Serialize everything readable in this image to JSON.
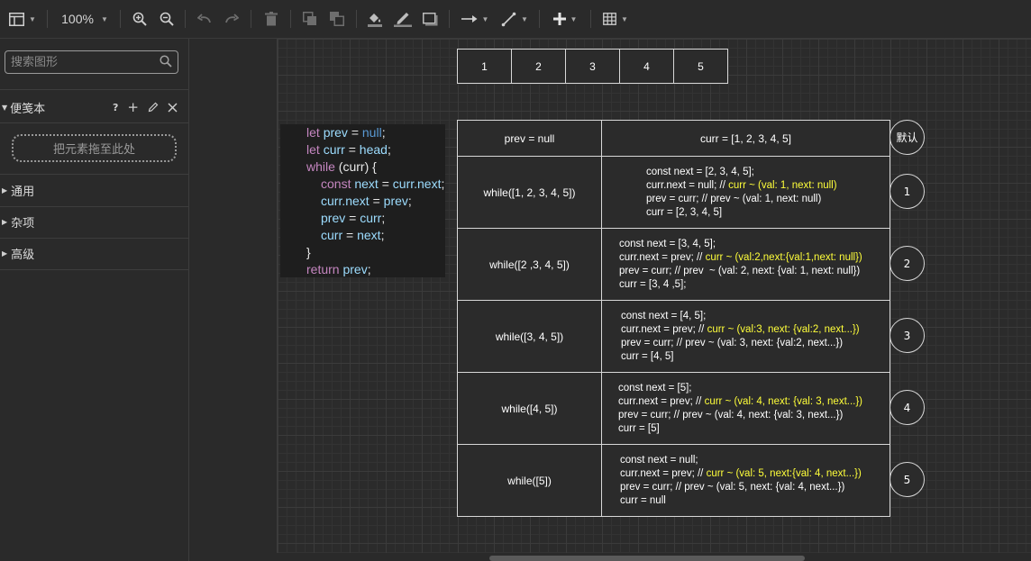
{
  "toolbar": {
    "zoom": "100%",
    "icons": [
      "panel-layout-icon",
      "zoom-in-icon",
      "zoom-out-icon",
      "undo-icon",
      "redo-icon",
      "delete-icon",
      "to-front-icon",
      "to-back-icon",
      "fill-color-icon",
      "line-color-icon",
      "shadow-icon",
      "connection-icon",
      "waypoints-icon",
      "insert-plus-icon",
      "table-icon"
    ]
  },
  "sidebar": {
    "search_placeholder": "搜索图形",
    "scratchpad": {
      "title": "便笺本",
      "help": "?",
      "add": "+"
    },
    "dropzone": "把元素拖至此处",
    "categories": [
      "通用",
      "杂项",
      "高级"
    ]
  },
  "diagram": {
    "array": [
      "1",
      "2",
      "3",
      "4",
      "5"
    ],
    "code": {
      "l1": [
        "let",
        "prev",
        "=",
        "null",
        ";"
      ],
      "l2": [
        "let",
        "curr",
        "=",
        "head",
        ";"
      ],
      "l3": [
        "while",
        "(curr) {"
      ],
      "l4": [
        "const",
        "next",
        "=",
        "curr.next",
        ";"
      ],
      "l5": [
        "curr.next",
        "=",
        "prev",
        ";"
      ],
      "l6": [
        "prev",
        "=",
        "curr",
        ";"
      ],
      "l7": [
        "curr",
        "=",
        "next",
        ";"
      ],
      "l8": "}",
      "l9": [
        "return",
        "prev",
        ";"
      ]
    },
    "header": {
      "left": "prev = null",
      "right": "curr = [1, 2, 3, 4, 5]",
      "badge": "默认"
    },
    "rows": [
      {
        "cond": "while([1, 2, 3, 4, 5])",
        "l1": "const next = [2, 3, 4, 5];",
        "l2a": "curr.next = null; // ",
        "l2b": "curr ~ (val: 1, next: null)",
        "l3": "prev = curr; // prev ~ (val: 1, next: null)",
        "l4": "curr = [2, 3, 4, 5]",
        "badge": "1"
      },
      {
        "cond": "while([2 ,3, 4, 5])",
        "l1": "const next = [3, 4, 5];",
        "l2a": "curr.next = prev; // ",
        "l2b": "curr ~ (val:2,next:{val:1,next: null})",
        "l3": "prev = curr; // prev  ~ (val: 2, next: {val: 1, next: null})",
        "l4": "curr = [3, 4 ,5];",
        "badge": "2"
      },
      {
        "cond": "while([3, 4, 5])",
        "l1": "const next = [4, 5];",
        "l2a": "curr.next = prev; // ",
        "l2b": "curr ~ (val:3, next: {val:2, next...})",
        "l3": "prev = curr; // prev ~ (val: 3, next: {val:2, next...})",
        "l4": "curr = [4, 5]",
        "badge": "3"
      },
      {
        "cond": "while([4, 5])",
        "l1": "const next = [5];",
        "l2a": "curr.next = prev; // ",
        "l2b": "curr ~ (val: 4, next: {val: 3, next...})",
        "l3": "prev = curr; // prev ~ (val: 4, next: {val: 3, next...})",
        "l4": "curr = [5]",
        "badge": "4"
      },
      {
        "cond": "while([5])",
        "l1": "const next = null;",
        "l2a": "curr.next = prev; // ",
        "l2b": "curr ~ (val: 5, next:{val: 4, next...})",
        "l3": "prev = curr; // prev ~ (val: 5, next: {val: 4, next...})",
        "l4": "curr = null",
        "badge": "5"
      }
    ]
  },
  "colors": {
    "background": "#2a2a2a",
    "grid": "#3b3b3b",
    "highlight": "#ffff3a",
    "keyword": "#c586c0",
    "identifier": "#9cdcfe"
  }
}
